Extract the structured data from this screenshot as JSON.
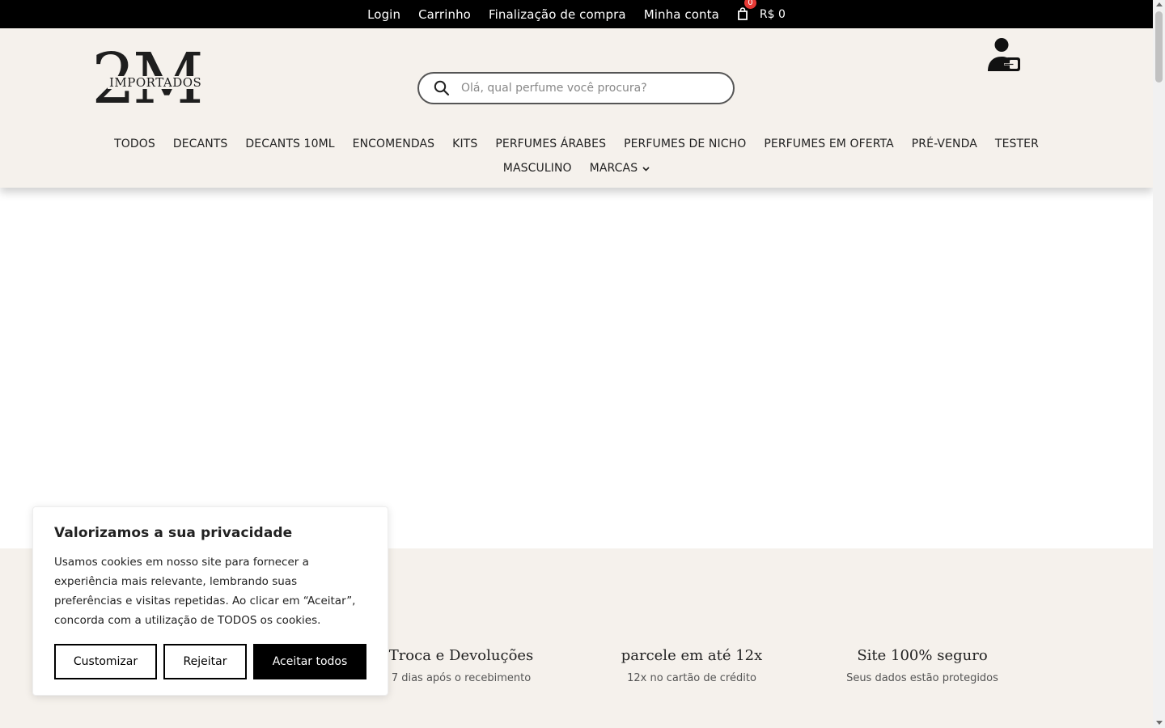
{
  "topbar": {
    "links": [
      "Login",
      "Carrinho",
      "Finalização de compra",
      "Minha conta"
    ],
    "cart_count": "0",
    "cart_total": "R$ 0"
  },
  "header": {
    "logo_big": "2M",
    "logo_small": "IMPORTADOS",
    "search_placeholder": "Olá, qual perfume você procura?"
  },
  "nav": {
    "row1": [
      "TODOS",
      "DECANTS",
      "DECANTS 10ML",
      "ENCOMENDAS",
      "KITS",
      "PERFUMES ÁRABES",
      "PERFUMES DE NICHO",
      "PERFUMES EM OFERTA",
      "PRÉ-VENDA",
      "TESTER"
    ],
    "row2": [
      "MASCULINO",
      "MARCAS"
    ]
  },
  "features": [
    {
      "title": "Troca e Devoluções",
      "subtitle": "7 dias após o recebimento"
    },
    {
      "title": "parcele em até 12x",
      "subtitle": "12x no cartão de crédito"
    },
    {
      "title": "Site 100% seguro",
      "subtitle": "Seus dados estão protegidos"
    }
  ],
  "cookie": {
    "title": "Valorizamos a sua privacidade",
    "body": "Usamos cookies em nosso site para fornecer a experiência mais relevante, lembrando suas preferências e visitas repetidas. Ao clicar em “Aceitar”, concorda com a utilização de TODOS os cookies.",
    "customize": "Customizar",
    "reject": "Rejeitar",
    "accept": "Aceitar todos"
  },
  "icons": {
    "cart": "shopping-bag-icon",
    "search": "search-icon",
    "login": "user-login-icon",
    "dropdown": "chevron-down-icon"
  },
  "colors": {
    "topbar": "#000000",
    "header_bg": "#f5f1ec",
    "badge": "#e53935"
  }
}
